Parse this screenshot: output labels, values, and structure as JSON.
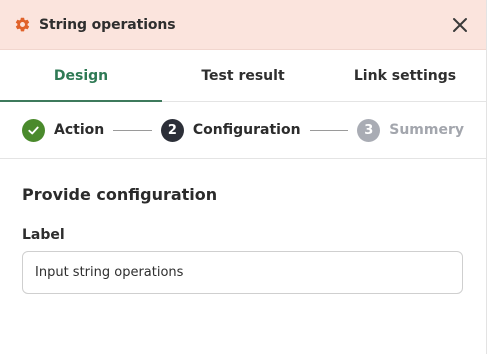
{
  "panel": {
    "title": "String operations",
    "icon": "gear-icon",
    "close_icon": "close-icon"
  },
  "tabs": [
    {
      "label": "Design",
      "active": true
    },
    {
      "label": "Test result",
      "active": false
    },
    {
      "label": "Link settings",
      "active": false
    }
  ],
  "stepper": {
    "steps": [
      {
        "number": "1",
        "label": "Action",
        "state": "done"
      },
      {
        "number": "2",
        "label": "Configuration",
        "state": "current"
      },
      {
        "number": "3",
        "label": "Summery",
        "state": "pending"
      }
    ]
  },
  "form": {
    "section_title": "Provide configuration",
    "label_field": {
      "label": "Label",
      "value": "Input string operations"
    }
  },
  "colors": {
    "header_bg": "#fbe4dd",
    "accent": "#2f7a55",
    "gear": "#e0622a",
    "step_done": "#4a8a2c",
    "step_current": "#2c2f38",
    "step_pending": "#a9acb4"
  }
}
